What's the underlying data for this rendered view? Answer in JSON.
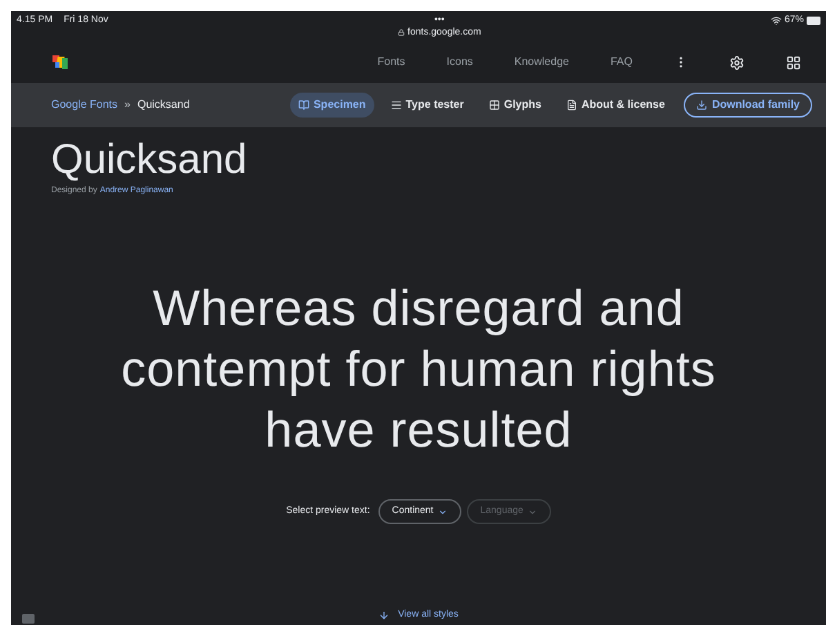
{
  "status_bar": {
    "time": "4.15 PM",
    "date": "Fri 18 Nov",
    "dots": "•••",
    "url": "fonts.google.com",
    "battery": "67%"
  },
  "nav": {
    "links": [
      "Fonts",
      "Icons",
      "Knowledge",
      "FAQ"
    ]
  },
  "breadcrumb": {
    "root": "Google Fonts",
    "separator": "»",
    "current": "Quicksand"
  },
  "tabs": [
    {
      "label": "Specimen",
      "selected": true,
      "kind": "specimen"
    },
    {
      "label": "Type tester",
      "selected": false,
      "kind": "tester"
    },
    {
      "label": "Glyphs",
      "selected": false,
      "kind": "glyphs"
    },
    {
      "label": "About & license",
      "selected": false,
      "kind": "about"
    }
  ],
  "download_button": "Download family",
  "font": {
    "name": "Quicksand",
    "designed_by": "Designed by",
    "designer": "Andrew Paglinawan"
  },
  "preview_text": "Whereas disregard and contempt for human rights have resulted",
  "preview_select": {
    "label": "Select preview text:",
    "dropdowns": [
      {
        "label": "Continent",
        "disabled": false
      },
      {
        "label": "Language",
        "disabled": true
      }
    ]
  },
  "view_all": "View all styles"
}
